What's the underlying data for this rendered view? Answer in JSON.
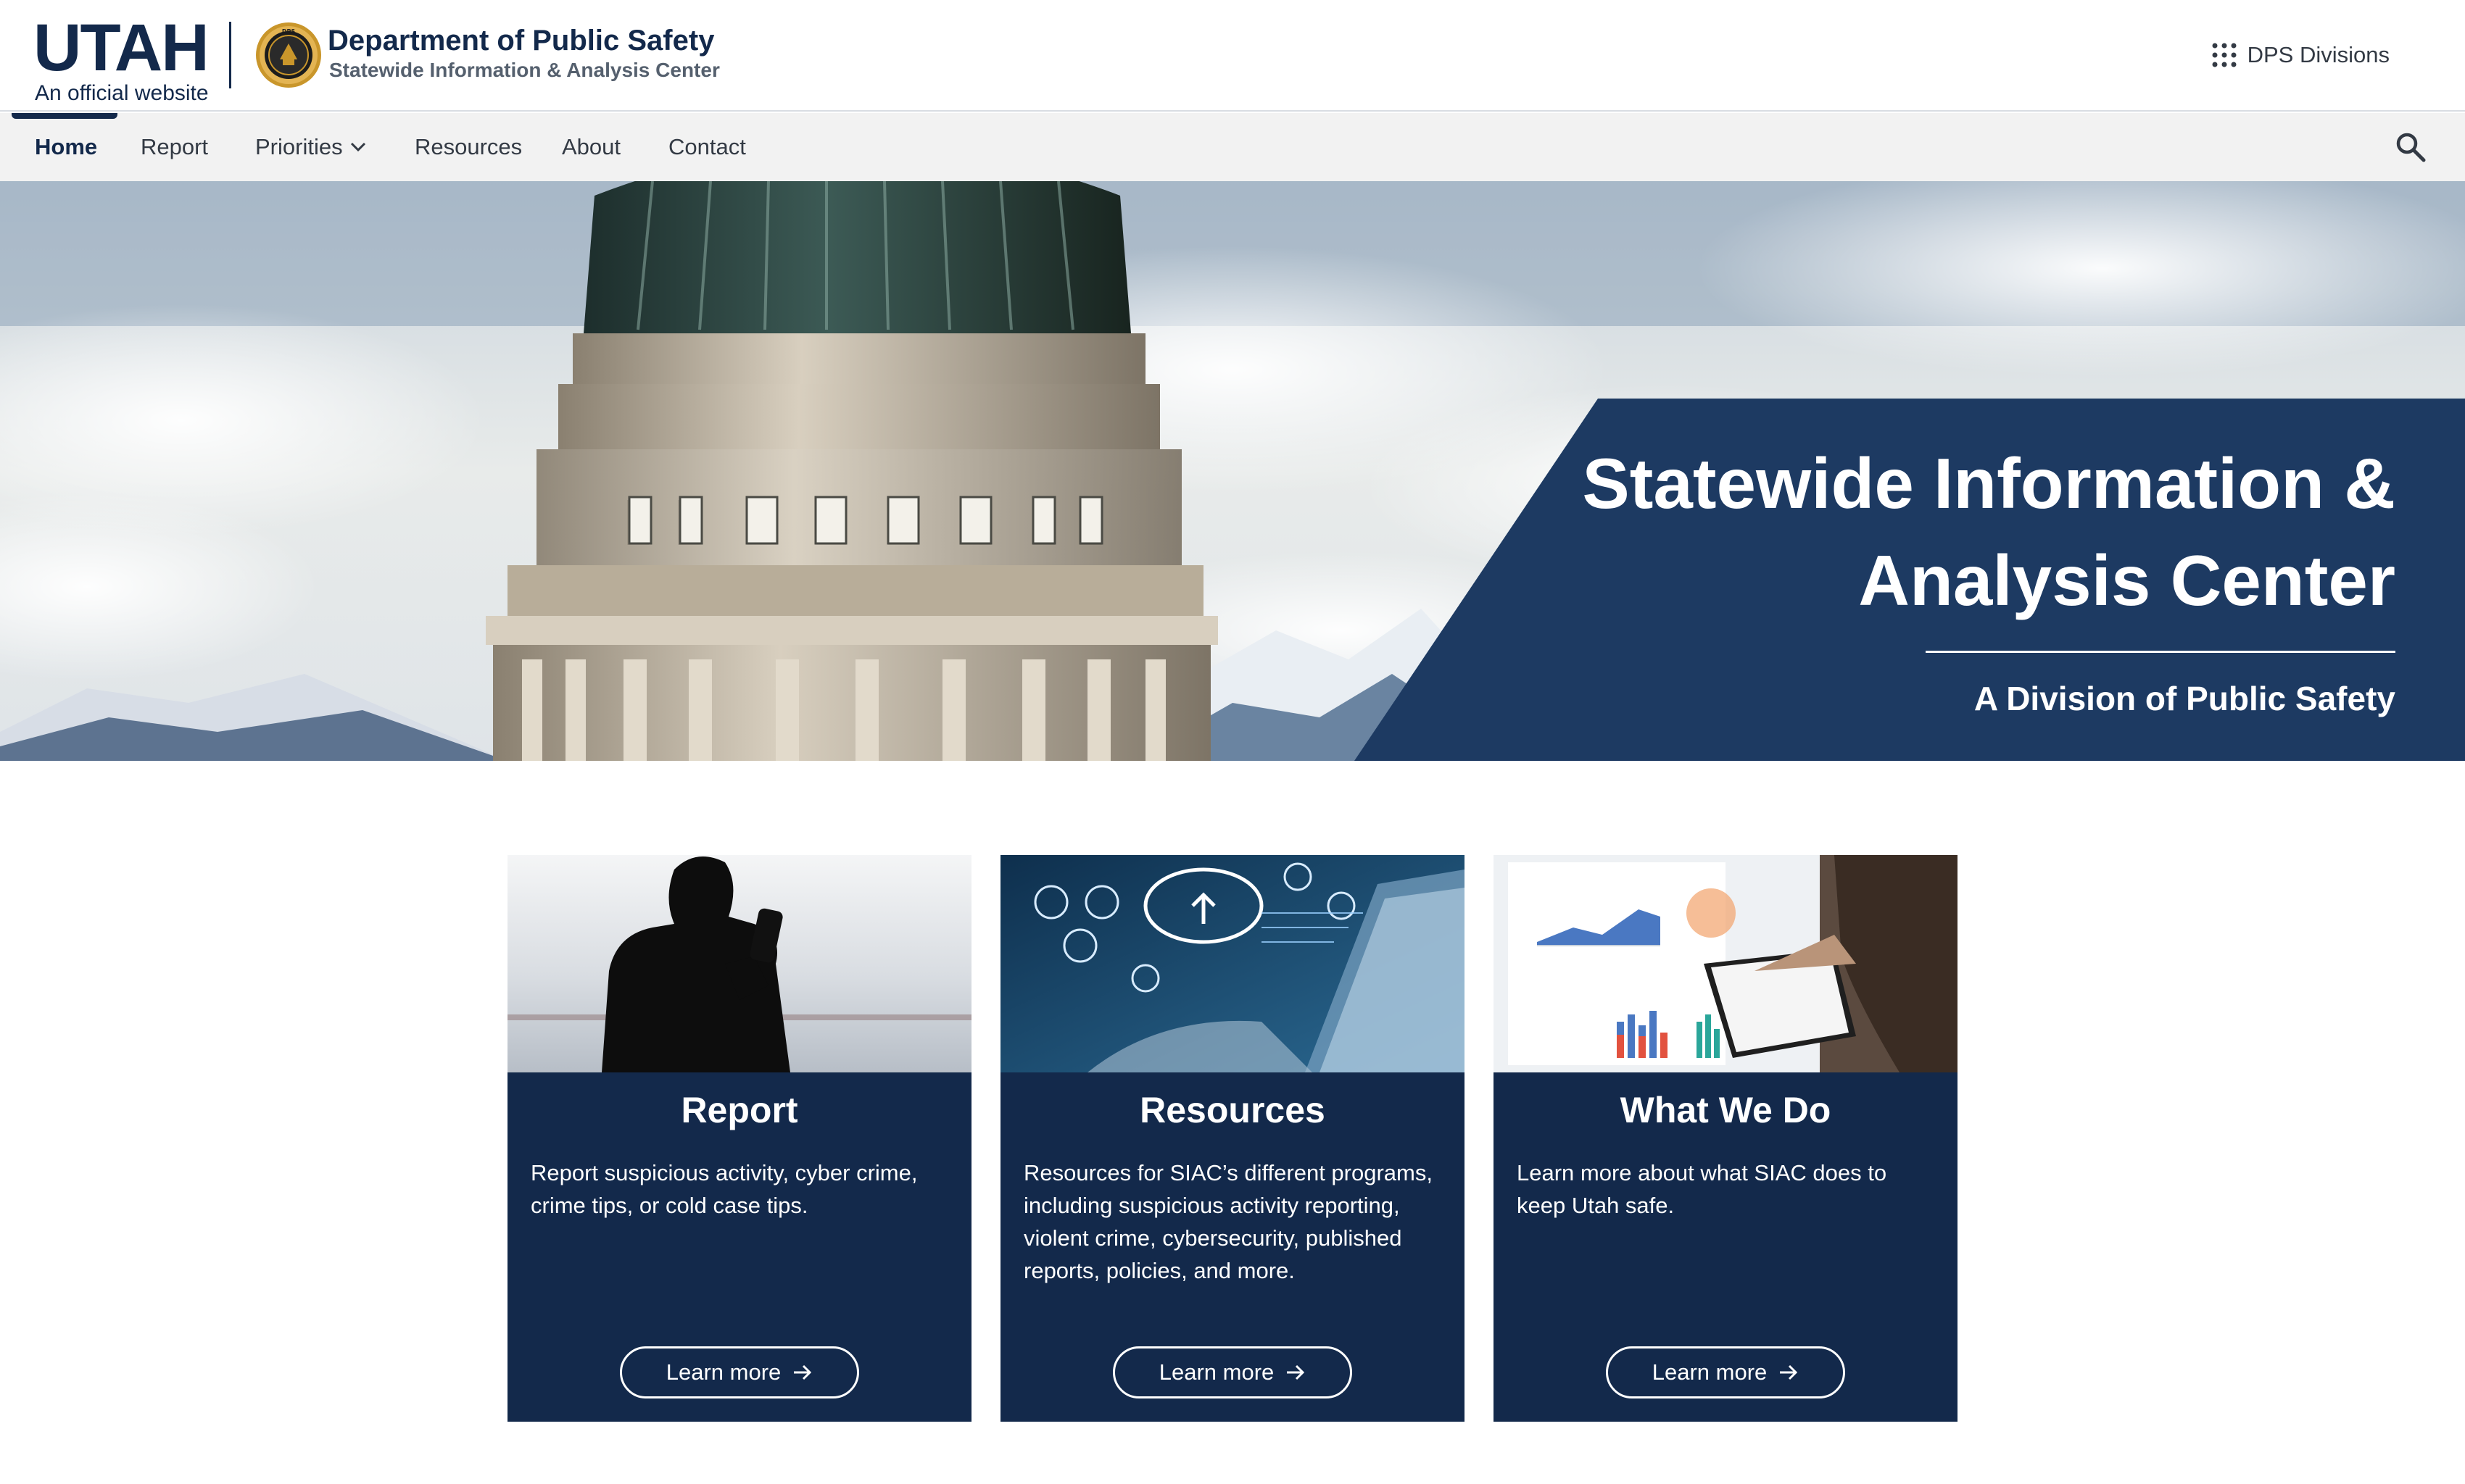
{
  "header": {
    "logo_word": "UTAH",
    "logo_official": "An official website",
    "dept_title": "Department of Public Safety",
    "dept_subtitle": "Statewide Information & Analysis Center",
    "divisions_label": "DPS Divisions",
    "divisions_icon": "grid-dots-icon"
  },
  "nav": {
    "items": [
      {
        "label": "Home",
        "active": true
      },
      {
        "label": "Report"
      },
      {
        "label": "Priorities",
        "has_dropdown": true
      },
      {
        "label": "Resources"
      },
      {
        "label": "About"
      },
      {
        "label": "Contact"
      }
    ],
    "search_icon": "search-icon"
  },
  "hero": {
    "title": "Statewide Information & Analysis Center",
    "subtitle": "A Division of Public Safety",
    "image": "capitol-dome-with-snowy-mountains"
  },
  "cards": [
    {
      "title": "Report",
      "description": "Report suspicious activity, cyber crime, crime tips, or cold case tips.",
      "button": "Learn more",
      "image": "person-silhouette-with-phone"
    },
    {
      "title": "Resources",
      "description": "Resources for SIAC’s different programs, including suspicious activity reporting, violent crime, cybersecurity, published reports, policies, and more.",
      "button": "Learn more",
      "image": "laptop-cloud-icons"
    },
    {
      "title": "What We Do",
      "description": "Learn more about what SIAC does to keep Utah safe.",
      "button": "Learn more",
      "image": "analytics-charts-notebook"
    }
  ],
  "colors": {
    "navy": "#13294b",
    "nav_background": "#f2f2f2",
    "hero_panel": "#1d3a62",
    "white": "#ffffff"
  }
}
